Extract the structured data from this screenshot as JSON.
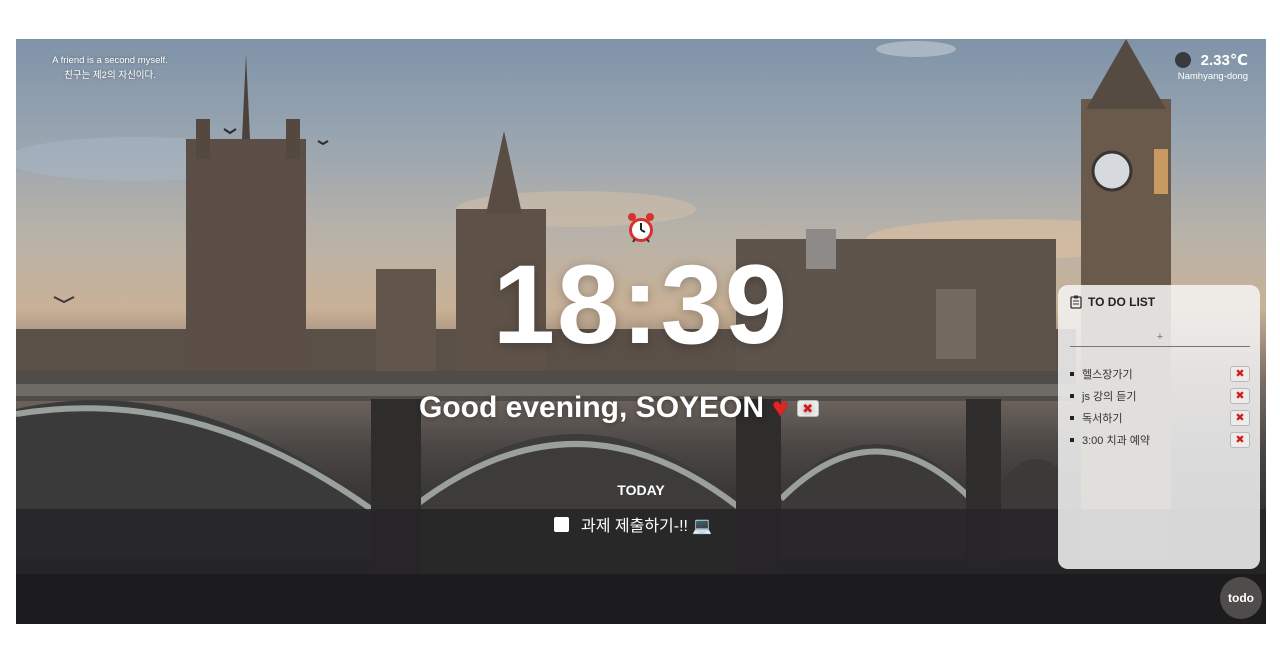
{
  "quote": {
    "en": "A friend is a second myself.",
    "ko": "친구는 제2의 자신이다."
  },
  "weather": {
    "icon": "weather-icon",
    "temperature": "2.33℃",
    "location": "Namhyang-dong"
  },
  "clock": {
    "icon": "alarm-clock-icon",
    "time": "18:39"
  },
  "greeting": {
    "text": "Good evening,  SOYEON",
    "icon": "heart-icon",
    "delete_label": "✖"
  },
  "today": {
    "title": "TODAY",
    "item": "과제 제출하기-!! 💻"
  },
  "todo_panel": {
    "icon": "clipboard-icon",
    "title": "TO DO LIST",
    "input_placeholder": "+",
    "items": [
      {
        "label": "헬스장가기",
        "delete_label": "✖"
      },
      {
        "label": "js 강의 듣기",
        "delete_label": "✖"
      },
      {
        "label": "독서하기",
        "delete_label": "✖"
      },
      {
        "label": "3:00 치과 예약",
        "delete_label": "✖"
      }
    ]
  },
  "todo_button": {
    "label": "todo"
  },
  "colors": {
    "accent_red": "#d11a1a",
    "panel_bg": "#f5f5f5",
    "text_light": "#ffffff"
  }
}
